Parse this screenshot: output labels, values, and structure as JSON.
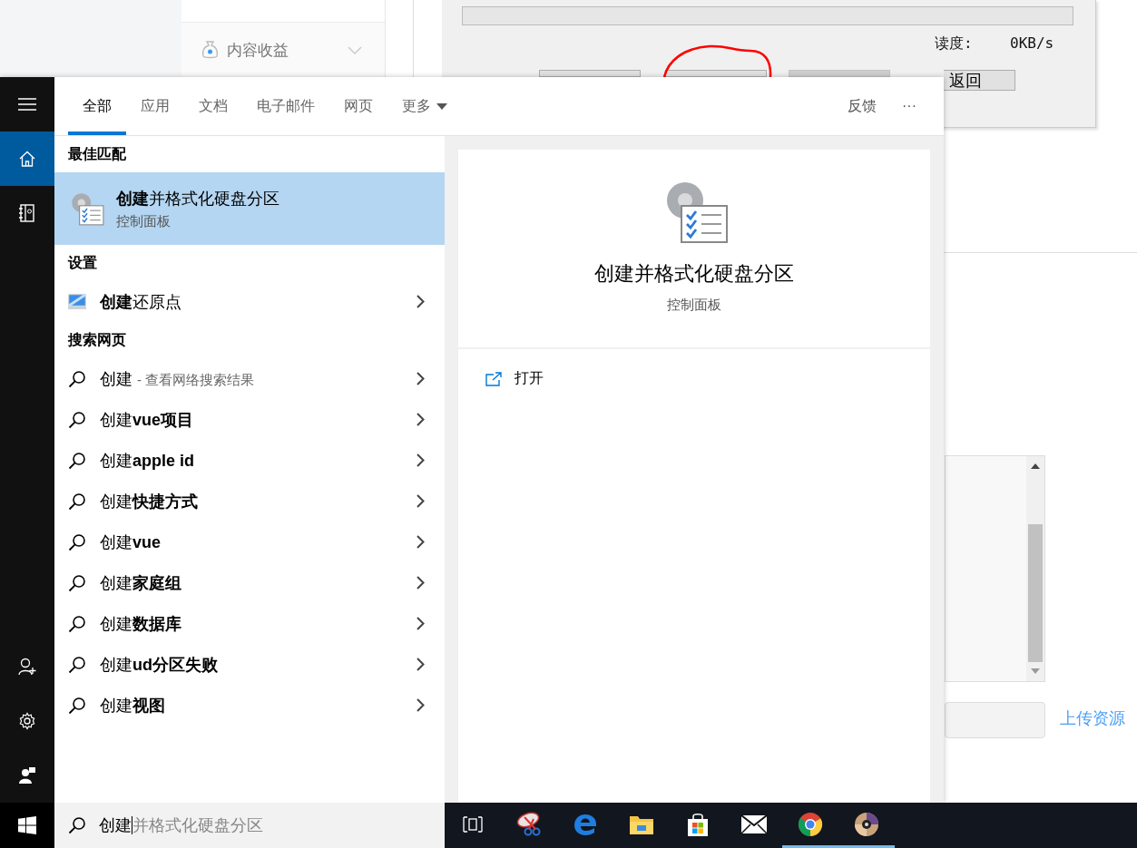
{
  "background_page": {
    "sidebar_item": "内容收益",
    "upload_link": "上传资源"
  },
  "background_dialog": {
    "progress": {
      "level": 0
    },
    "speed_label": "读度:",
    "speed_value": "0KB/s",
    "back_button": "返回"
  },
  "rail": {
    "items": [
      {
        "kind": "menu",
        "selected": false
      },
      {
        "kind": "home",
        "selected": true
      },
      {
        "kind": "notebook",
        "selected": false
      }
    ],
    "bottom_items": [
      {
        "kind": "person-add",
        "selected": false
      },
      {
        "kind": "settings",
        "selected": false
      },
      {
        "kind": "feedback",
        "selected": false
      }
    ]
  },
  "tabs": [
    {
      "label": "全部",
      "selected": true
    },
    {
      "label": "应用",
      "selected": false
    },
    {
      "label": "文档",
      "selected": false
    },
    {
      "label": "电子邮件",
      "selected": false
    },
    {
      "label": "网页",
      "selected": false
    },
    {
      "label": "更多",
      "selected": false,
      "dropdown": true
    }
  ],
  "feedback": "反馈",
  "more_menu": "···",
  "best_match": {
    "heading": "最佳匹配",
    "title": "**创建**并格式化硬盘分区",
    "subtitle": "控制面板",
    "selected": true
  },
  "settings": {
    "heading": "设置",
    "items": [
      {
        "label": "**创建**还原点"
      }
    ]
  },
  "web": {
    "heading": "搜索网页",
    "items": [
      {
        "label": "创建",
        "hint": "- 查看网络搜索结果"
      },
      {
        "label": "创建**vue项目**"
      },
      {
        "label": "创建**apple id**"
      },
      {
        "label": "创建**快捷方式**"
      },
      {
        "label": "创建**vue**"
      },
      {
        "label": "创建**家庭组**"
      },
      {
        "label": "创建**数据库**"
      },
      {
        "label": "创建**ud分区失败**"
      },
      {
        "label": "创建**视图**"
      }
    ]
  },
  "preview": {
    "title": "创建并格式化硬盘分区",
    "subtitle": "控制面板",
    "actions": [
      {
        "label": "打开"
      }
    ]
  },
  "search_box": {
    "value": "创建",
    "suggestion": "并格式化硬盘分区"
  },
  "taskbar": {
    "apps": [
      {
        "kind": "task-view",
        "running": false
      },
      {
        "kind": "snipping",
        "running": false
      },
      {
        "kind": "edge",
        "running": false
      },
      {
        "kind": "explorer",
        "running": false
      },
      {
        "kind": "store",
        "running": false
      },
      {
        "kind": "mail",
        "running": false
      },
      {
        "kind": "chrome",
        "running": true
      },
      {
        "kind": "media",
        "running": true
      }
    ]
  }
}
